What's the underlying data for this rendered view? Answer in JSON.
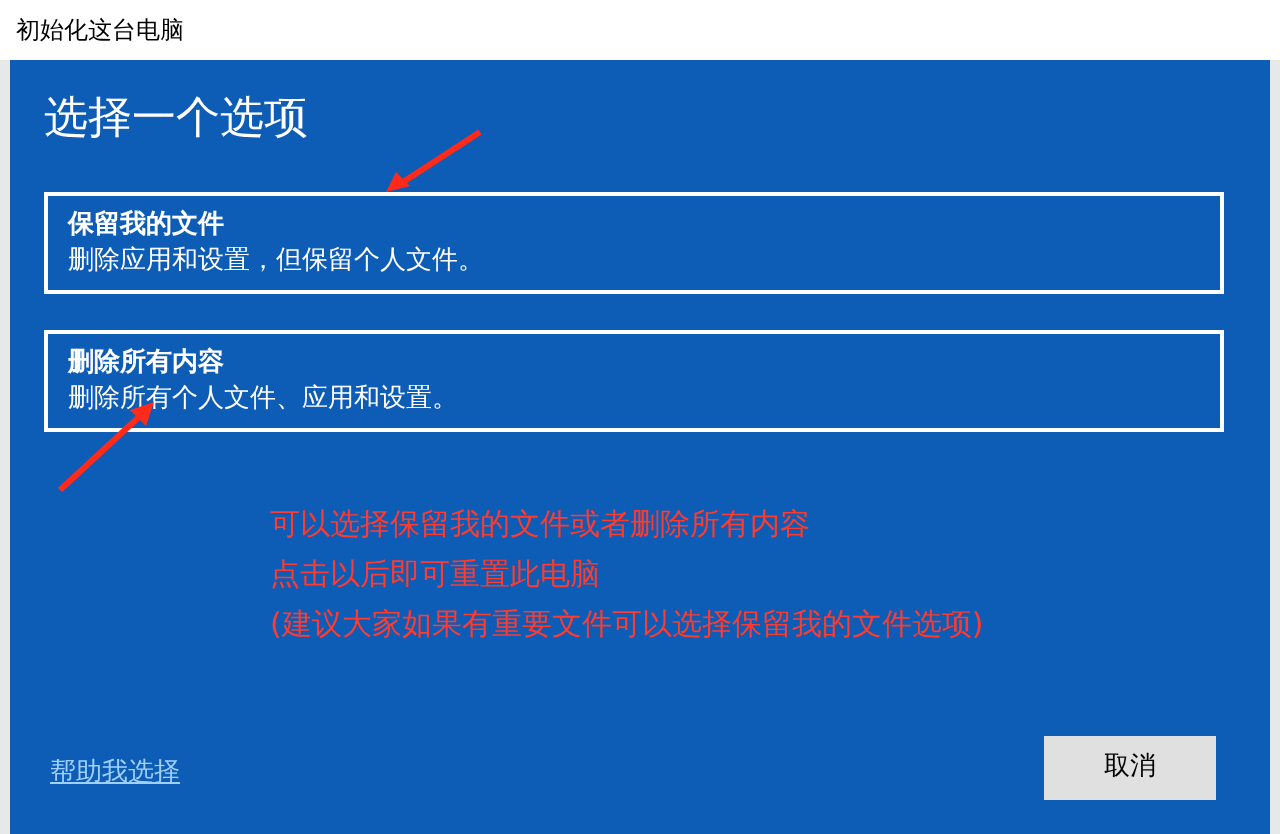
{
  "window": {
    "title": "初始化这台电脑"
  },
  "heading": "选择一个选项",
  "options": [
    {
      "title": "保留我的文件",
      "description": "删除应用和设置，但保留个人文件。"
    },
    {
      "title": "删除所有内容",
      "description": "删除所有个人文件、应用和设置。"
    }
  ],
  "annotation": [
    "可以选择保留我的文件或者删除所有内容",
    "点击以后即可重置此电脑",
    "(建议大家如果有重要文件可以选择保留我的文件选项)"
  ],
  "help_link": "帮助我选择",
  "cancel_button": "取消"
}
